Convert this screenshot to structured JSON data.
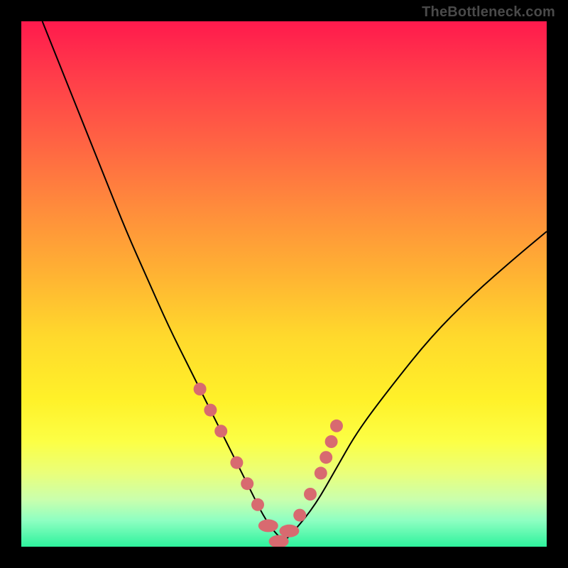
{
  "watermark": "TheBottleneck.com",
  "chart_data": {
    "type": "line",
    "title": "",
    "xlabel": "",
    "ylabel": "",
    "xlim": [
      0,
      100
    ],
    "ylim": [
      0,
      100
    ],
    "grid": false,
    "legend": false,
    "series": [
      {
        "name": "bottleneck-curve",
        "x": [
          4,
          8,
          12,
          16,
          20,
          24,
          28,
          32,
          36,
          40,
          44,
          46,
          48,
          50,
          52,
          56,
          60,
          64,
          70,
          78,
          86,
          94,
          100
        ],
        "y": [
          100,
          90,
          80,
          70,
          60,
          51,
          42,
          34,
          26,
          18,
          10,
          6,
          3,
          1,
          3,
          8,
          15,
          22,
          30,
          40,
          48,
          55,
          60
        ]
      }
    ],
    "markers": {
      "name": "highlighted-points",
      "color": "#d86a70",
      "x": [
        34,
        36,
        38,
        41,
        43,
        45,
        47,
        49,
        51,
        53,
        55,
        57,
        58,
        59,
        60
      ],
      "y": [
        30,
        26,
        22,
        16,
        12,
        8,
        4,
        1,
        3,
        6,
        10,
        14,
        17,
        20,
        23
      ]
    },
    "background_gradient": {
      "top": "#ff1a4d",
      "middle": "#ffd92c",
      "bottom": "#2ef29d"
    }
  }
}
